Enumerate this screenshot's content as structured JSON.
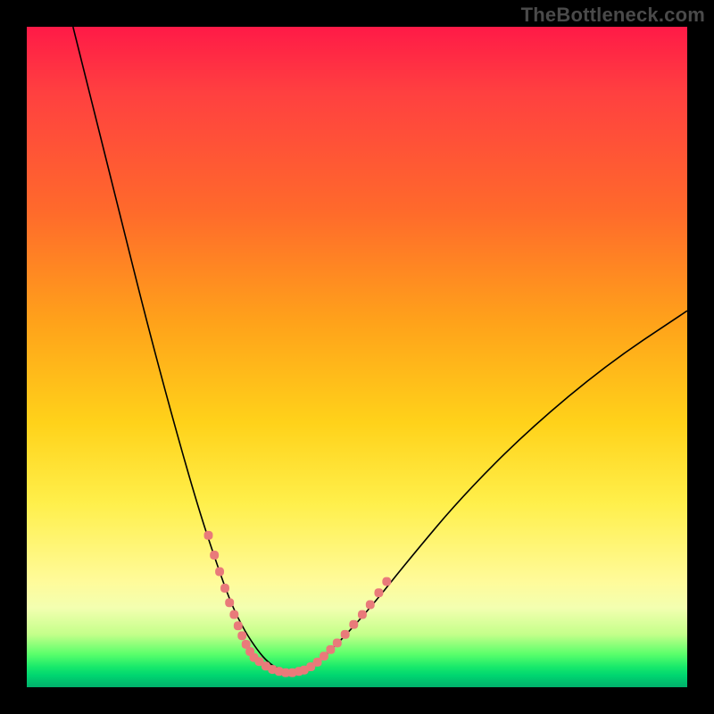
{
  "watermark": "TheBottleneck.com",
  "chart_data": {
    "type": "line",
    "title": "",
    "xlabel": "",
    "ylabel": "",
    "xlim": [
      0,
      100
    ],
    "ylim": [
      0,
      100
    ],
    "grid": false,
    "legend": false,
    "series": [
      {
        "name": "bottleneck-curve",
        "stroke": "#000000",
        "stroke_width": 1.6,
        "x": [
          7,
          10,
          14,
          18,
          22,
          26,
          29,
          31,
          33,
          35,
          36.5,
          38,
          40,
          42,
          44,
          47,
          52,
          58,
          66,
          76,
          88,
          100
        ],
        "values": [
          100,
          88,
          72,
          56,
          41,
          27,
          18,
          12.5,
          8.5,
          5.5,
          3.8,
          2.8,
          2.2,
          2.6,
          3.8,
          6.5,
          12,
          19.5,
          29,
          39,
          49,
          57
        ]
      },
      {
        "name": "highlight-dots-left",
        "type": "scatter",
        "color": "#e97a7a",
        "marker_size": 9,
        "x": [
          27.5,
          28.4,
          29.2,
          30.0,
          30.7,
          31.4,
          32.0,
          32.6,
          33.2,
          33.8,
          34.4
        ],
        "values": [
          23.0,
          20.0,
          17.5,
          15.0,
          12.8,
          11.0,
          9.3,
          7.8,
          6.5,
          5.4,
          4.5
        ]
      },
      {
        "name": "highlight-dots-right",
        "type": "scatter",
        "color": "#e97a7a",
        "marker_size": 9,
        "x": [
          42.0,
          43.0,
          44.0,
          45.0,
          46.0,
          47.0,
          48.2,
          49.5,
          50.8,
          52.0,
          53.3,
          54.5
        ],
        "values": [
          2.6,
          3.1,
          3.8,
          4.7,
          5.7,
          6.7,
          8.0,
          9.5,
          11.0,
          12.5,
          14.3,
          16.0
        ]
      },
      {
        "name": "highlight-dots-bottom",
        "type": "scatter",
        "color": "#e97a7a",
        "marker_size": 9,
        "x": [
          35.2,
          36.2,
          37.2,
          38.2,
          39.2,
          40.2,
          41.2
        ],
        "values": [
          3.9,
          3.2,
          2.7,
          2.4,
          2.2,
          2.2,
          2.4
        ]
      }
    ],
    "background_gradient_stops": [
      {
        "pos": 0.0,
        "color": "#ff1a47"
      },
      {
        "pos": 0.28,
        "color": "#ff6a2b"
      },
      {
        "pos": 0.6,
        "color": "#ffd21a"
      },
      {
        "pos": 0.84,
        "color": "#fffb9a"
      },
      {
        "pos": 0.95,
        "color": "#5aff6b"
      },
      {
        "pos": 1.0,
        "color": "#00b06b"
      }
    ]
  }
}
